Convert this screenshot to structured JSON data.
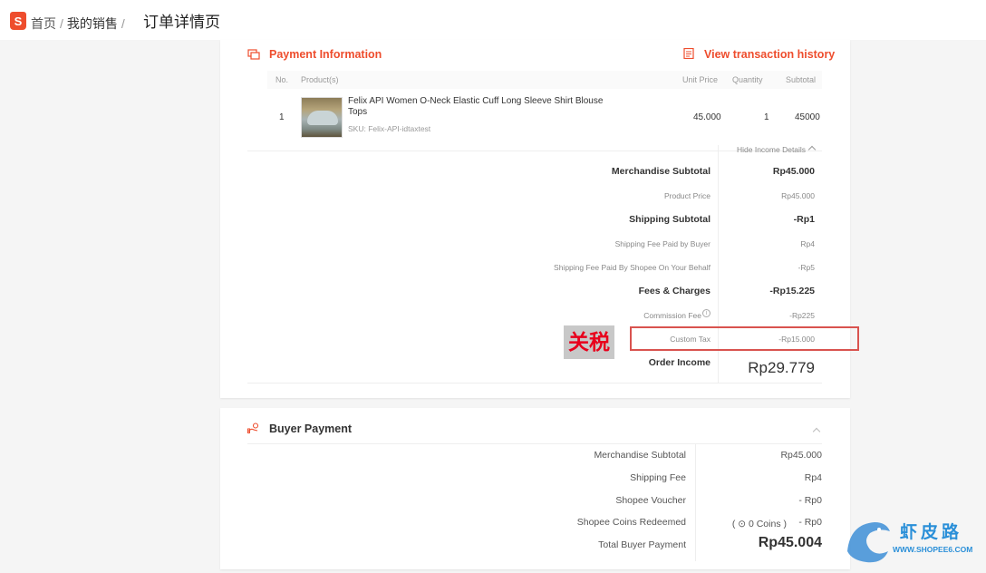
{
  "breadcrumb": {
    "logo_letter": "S",
    "home": "首页",
    "sep": "/",
    "my_sales": "我的销售",
    "sep2": "/"
  },
  "page_title": "订单详情页",
  "payment": {
    "title": "Payment Information",
    "history_link": "View transaction history",
    "columns": {
      "no": "No.",
      "products": "Product(s)",
      "unit_price": "Unit Price",
      "quantity": "Quantity",
      "subtotal": "Subtotal"
    },
    "item": {
      "no": "1",
      "name": "Felix API Women O-Neck Elastic Cuff Long Sleeve Shirt Blouse Tops",
      "sku": "SKU: Felix-API-idtaxtest",
      "unit_price": "45.000",
      "quantity": "1",
      "subtotal": "45000"
    },
    "hide_income": "Hide Income Details",
    "income": {
      "merch_subtotal_label": "Merchandise Subtotal",
      "merch_subtotal_value": "Rp45.000",
      "product_price_label": "Product Price",
      "product_price_value": "Rp45.000",
      "shipping_subtotal_label": "Shipping Subtotal",
      "shipping_subtotal_value": "-Rp1",
      "ship_buyer_label": "Shipping Fee Paid by Buyer",
      "ship_buyer_value": "Rp4",
      "ship_shopee_label": "Shipping Fee Paid By Shopee On Your Behalf",
      "ship_shopee_value": "-Rp5",
      "fees_label": "Fees & Charges",
      "fees_value": "-Rp15.225",
      "commission_label": "Commission Fee",
      "commission_value": "-Rp225",
      "custom_tax_label": "Custom Tax",
      "custom_tax_value": "-Rp15.000",
      "order_income_label": "Order Income",
      "order_income_value": "Rp29.779"
    },
    "annotation": "关税"
  },
  "buyer_payment": {
    "title": "Buyer Payment",
    "rows": {
      "merch_label": "Merchandise Subtotal",
      "merch_value": "Rp45.000",
      "shipping_label": "Shipping Fee",
      "shipping_value": "Rp4",
      "voucher_label": "Shopee Voucher",
      "voucher_value": "- Rp0",
      "coins_label": "Shopee Coins Redeemed",
      "coins_note": "( ⊙ 0 Coins )",
      "coins_value": "- Rp0",
      "total_label": "Total Buyer Payment",
      "total_value": "Rp45.004"
    }
  },
  "watermark": {
    "cn": "虾皮路",
    "url": "WWW.SHOPEE6.COM"
  },
  "colors": {
    "accent": "#ee4d2d",
    "highlight_box": "#d9534f",
    "watermark": "#2a8fd8"
  }
}
